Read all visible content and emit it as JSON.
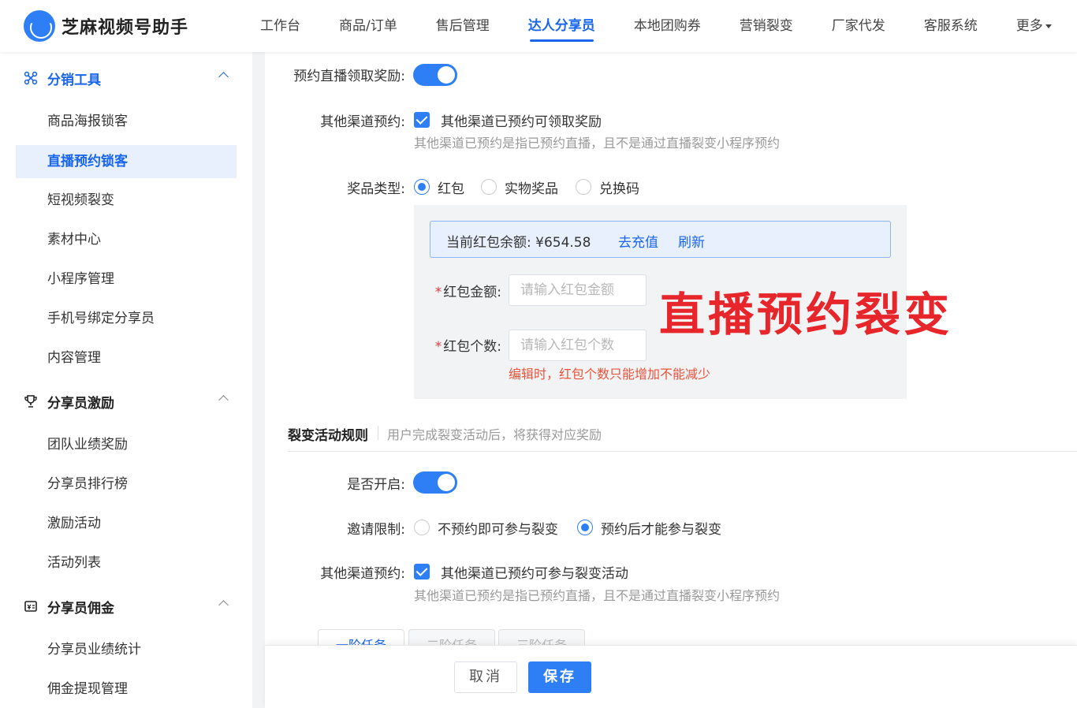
{
  "app": {
    "title": "芝麻视频号助手"
  },
  "nav": {
    "items": [
      "工作台",
      "商品/订单",
      "售后管理",
      "达人分享员",
      "本地团购券",
      "营销裂变",
      "厂家代发",
      "客服系统"
    ],
    "active": "达人分享员",
    "more": "更多"
  },
  "sidebar": {
    "groups": [
      {
        "label": "分销工具",
        "icon": "network-icon",
        "items": [
          "商品海报锁客",
          "直播预约锁客",
          "短视频裂变",
          "素材中心",
          "小程序管理",
          "手机号绑定分享员",
          "内容管理"
        ]
      },
      {
        "label": "分享员激励",
        "icon": "trophy-icon",
        "items": [
          "团队业绩奖励",
          "分享员排行榜",
          "激励活动",
          "活动列表"
        ]
      },
      {
        "label": "分享员佣金",
        "icon": "commission-icon",
        "items": [
          "分享员业绩统计",
          "佣金提现管理"
        ]
      }
    ],
    "active_item": "直播预约锁客"
  },
  "form": {
    "reserve_reward_label": "预约直播领取奖励:",
    "reserve_reward_on": true,
    "other_channel_label": "其他渠道预约:",
    "other_channel_check_text": "其他渠道已预约可领取奖励",
    "other_channel_hint": "其他渠道已预约是指已预约直播，且不是通过直播裂变小程序预约",
    "prize_type_label": "奖品类型:",
    "prize_options": [
      "红包",
      "实物奖品",
      "兑换码"
    ],
    "prize_selected": "红包",
    "balance_text": "当前红包余额:  ¥654.58",
    "recharge_link": "去充值",
    "refresh_link": "刷新",
    "amount_label": "红包金额:",
    "amount_placeholder": "请输入红包金额",
    "count_label": "红包个数:",
    "count_placeholder": "请输入红包个数",
    "count_warning": "编辑时，红包个数只能增加不能减少",
    "required_mark": "*"
  },
  "overlay_title": "直播预约裂变",
  "rules": {
    "title": "裂变活动规则",
    "desc": "用户完成裂变活动后，将获得对应奖励",
    "enable_label": "是否开启:",
    "enable_on": true,
    "invite_limit_label": "邀请限制:",
    "invite_options": [
      "不预约即可参与裂变",
      "预约后才能参与裂变"
    ],
    "invite_selected": "预约后才能参与裂变",
    "other_channel_label": "其他渠道预约:",
    "other_channel_check_text": "其他渠道已预约可参与裂变活动",
    "other_channel_hint": "其他渠道已预约是指已预约直播，且不是通过直播裂变小程序预约",
    "tabs": [
      "一阶任务",
      "二阶任务",
      "三阶任务"
    ]
  },
  "footer": {
    "cancel": "取消",
    "save": "保存"
  },
  "colors": {
    "accent": "#2e7ff5",
    "active_nav": "#1a66ee",
    "warning": "#e8533a",
    "overlay_red": "#e6262a"
  }
}
